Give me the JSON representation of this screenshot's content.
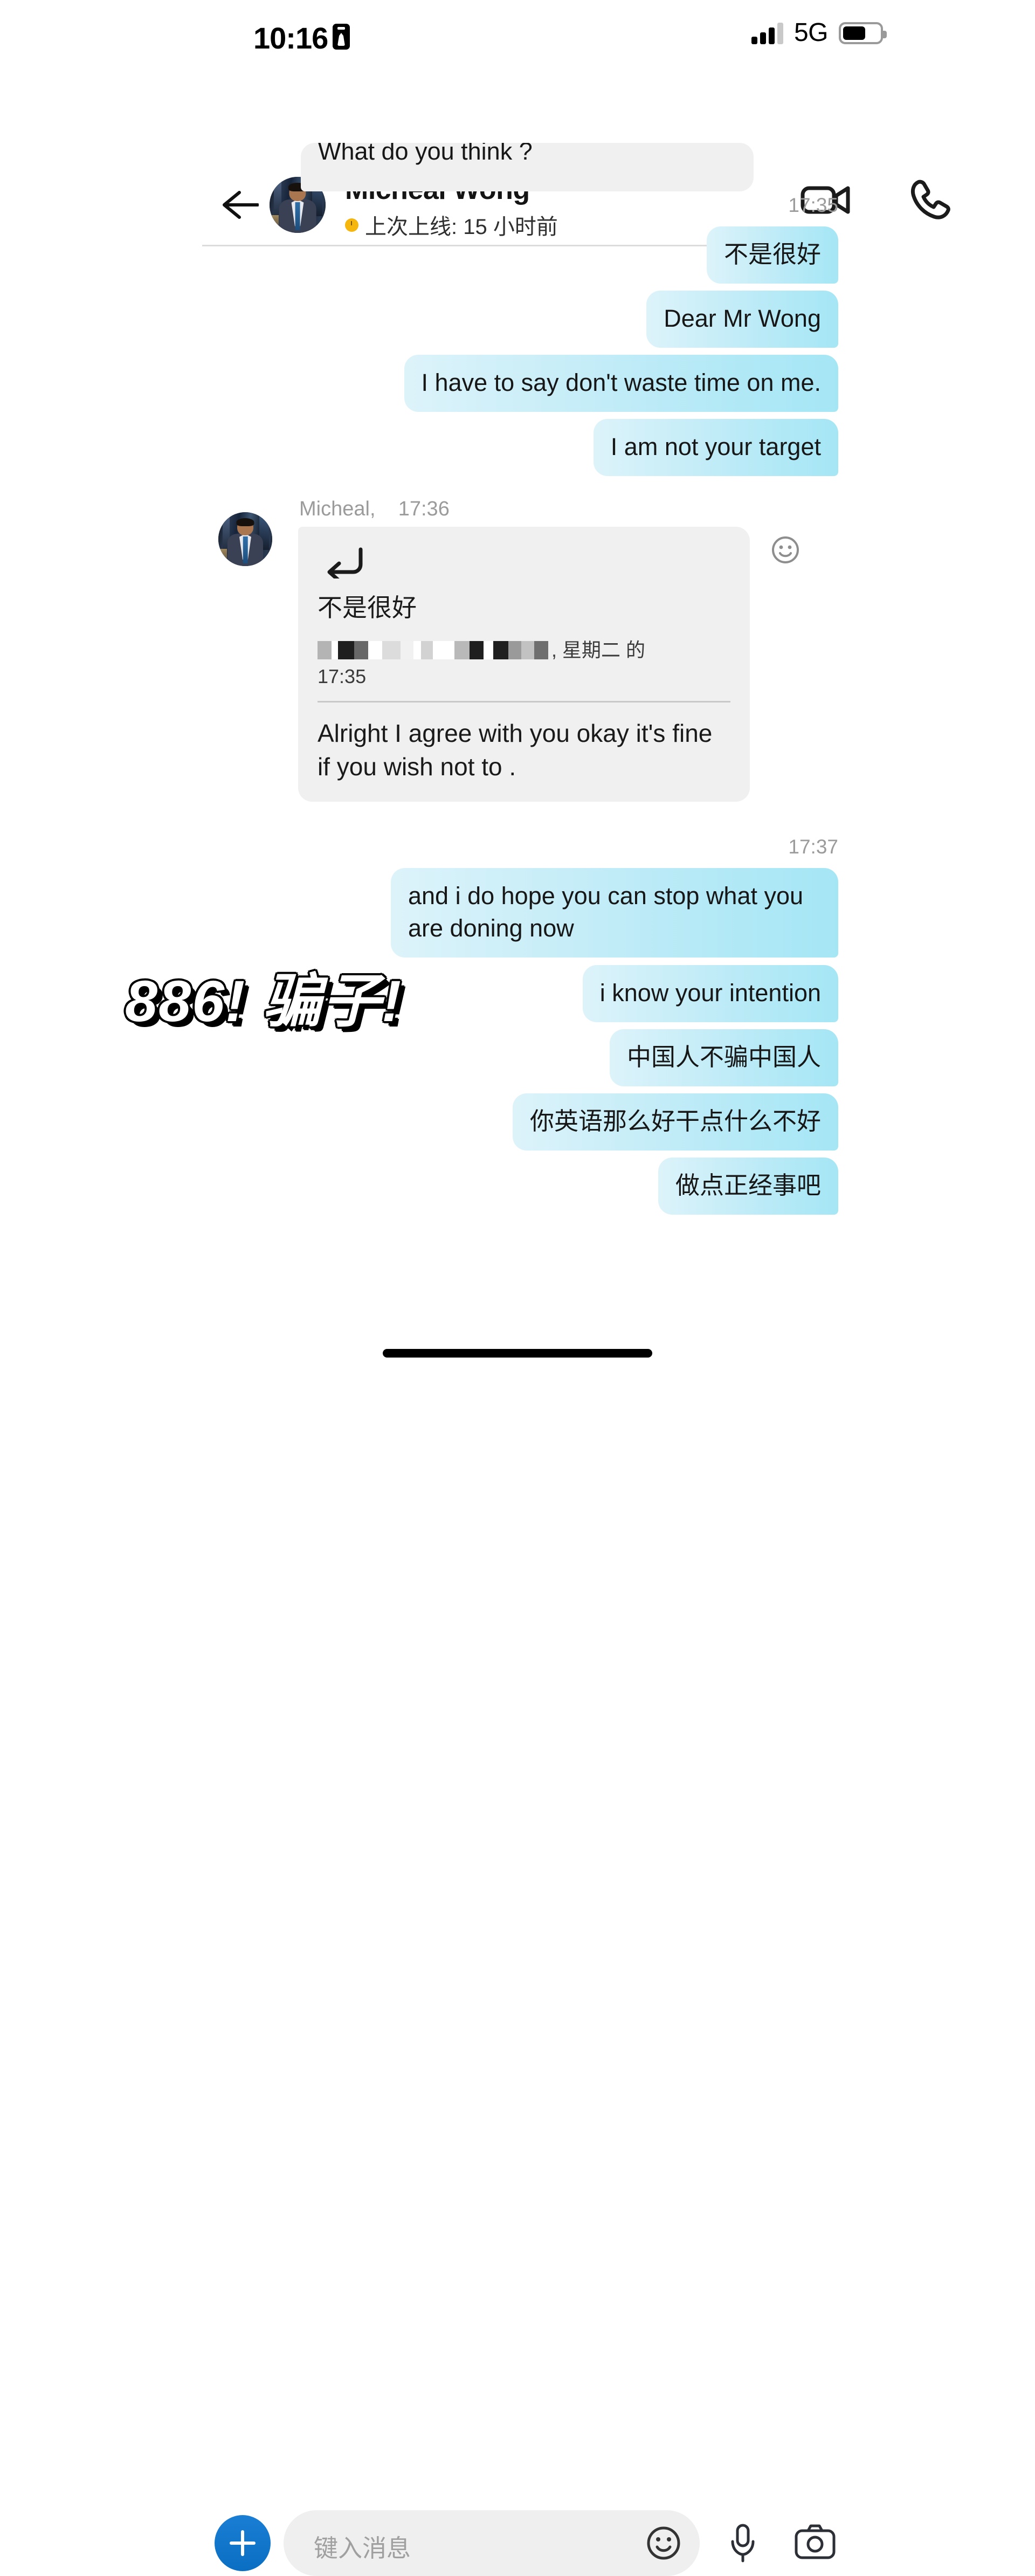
{
  "status_bar": {
    "time": "10:16",
    "badge_icon": "id-badge-icon",
    "signal_icon": "signal-bars-icon",
    "network": "5G",
    "battery_icon": "battery-icon",
    "battery_level_pct": 60
  },
  "header": {
    "back_icon": "back-arrow-icon",
    "avatar_icon": "contact-avatar",
    "name": "Micheal Wong",
    "presence_dot_color": "#f5b60d",
    "presence_text": "上次上线: 15 小时前",
    "video_call_icon": "video-camera-icon",
    "voice_call_icon": "phone-icon"
  },
  "chat": {
    "clipped_top_message": "What do you think ?",
    "timestamp_1": "17:35",
    "outgoing_1": [
      "不是很好",
      "Dear Mr Wong",
      "I have to say don't waste time on me.",
      "I am not your target"
    ],
    "incoming": {
      "sender_label": "Micheal,",
      "time_label": "17:36",
      "reply_icon": "reply-arrow-icon",
      "quote_text": "不是很好",
      "quote_attr_redacted": "███ ██ █ ███ ████",
      "quote_attr_suffix": ", 星期二 的",
      "quote_time": "17:35",
      "body": "Alright I agree with you okay it's fine if you wish not to .",
      "reaction_icon": "smiley-reaction-icon"
    },
    "timestamp_2": "17:37",
    "outgoing_2": [
      "and i do hope you can stop what you are doning now",
      "i know your intention",
      "中国人不骗中国人",
      "你英语那么好干点什么不好",
      "做点正经事吧"
    ],
    "sticker_overlay": "886!  骗子!",
    "bubble_color_out_start": "#ddf3fa",
    "bubble_color_out_end": "#a5e6f5",
    "bubble_color_in": "#f0f0f0"
  },
  "composer": {
    "add_icon": "plus-icon",
    "add_button_color": "#0a6ec2",
    "input_placeholder": "键入消息",
    "input_value": "",
    "emoji_icon": "smiley-icon",
    "mic_icon": "microphone-icon",
    "camera_icon": "camera-icon"
  },
  "system": {
    "home_indicator": "home-indicator"
  }
}
